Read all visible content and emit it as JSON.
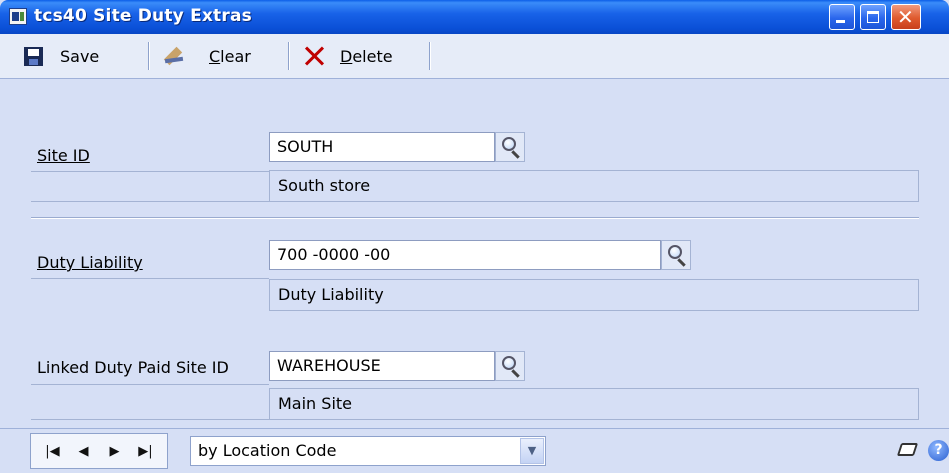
{
  "window": {
    "title": "tcs40 Site Duty Extras",
    "controls": [
      "minimize",
      "maximize",
      "close"
    ]
  },
  "toolbar": {
    "save_label": "Save",
    "clear_prefix": "C",
    "clear_rest": "lear",
    "delete_prefix": "D",
    "delete_rest": "elete"
  },
  "form": {
    "site_id": {
      "label": "Site ID",
      "value": "SOUTH",
      "description": "South store"
    },
    "duty_liability": {
      "label": "Duty Liability",
      "value": "700 -0000 -00",
      "description": "Duty Liability"
    },
    "linked_site": {
      "label": "Linked Duty Paid Site ID",
      "value": "WAREHOUSE",
      "description": "Main Site"
    }
  },
  "bottom": {
    "nav": [
      "first",
      "previous",
      "next",
      "last"
    ],
    "nav_glyphs": [
      "|◀",
      "◀",
      "▶",
      "▶|"
    ],
    "sort_by": "by Location Code",
    "dropdown_glyph": "▼",
    "help_glyph": "?"
  },
  "colors": {
    "titlebar": "#0a4fd6",
    "window_bg": "#d6dff5",
    "delete_red": "#c00000"
  }
}
